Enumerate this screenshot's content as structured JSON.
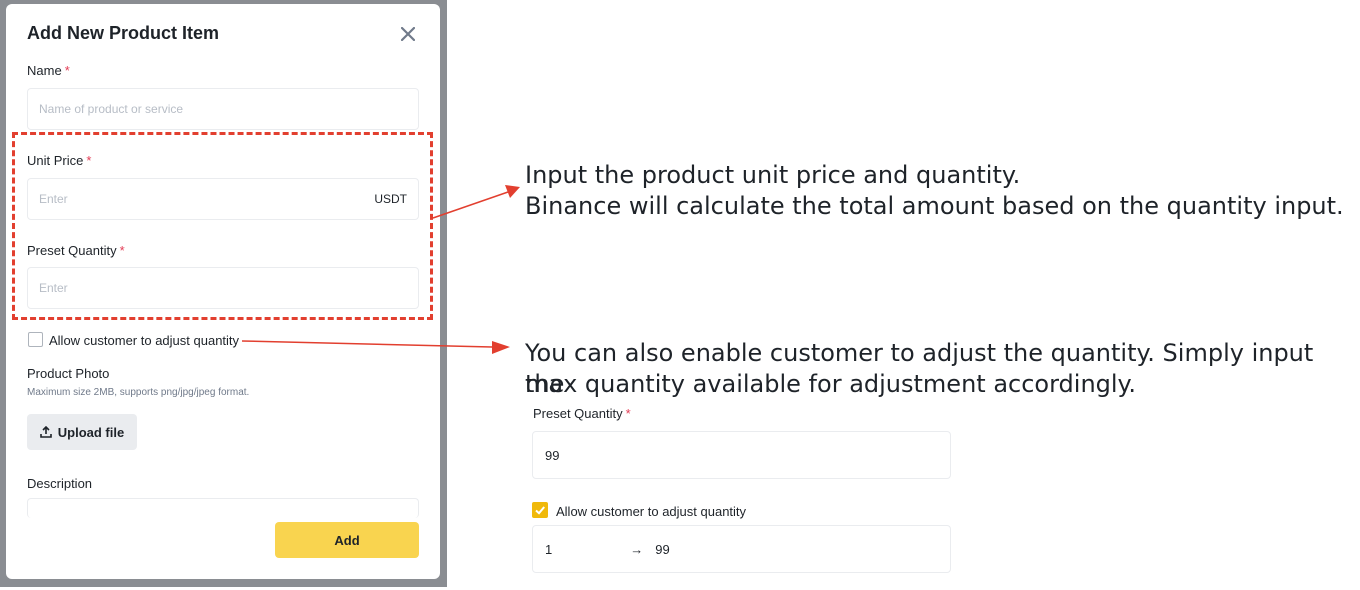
{
  "modal": {
    "title": "Add New Product Item",
    "name_label": "Name",
    "name_placeholder": "Name of product or service",
    "unit_price_label": "Unit Price",
    "unit_price_placeholder": "Enter",
    "unit_price_suffix": "USDT",
    "preset_qty_label": "Preset Quantity",
    "preset_qty_placeholder": "Enter",
    "allow_adjust_label": "Allow customer to adjust quantity",
    "product_photo_label": "Product Photo",
    "product_photo_hint": "Maximum size 2MB, supports png/jpg/jpeg format.",
    "upload_label": "Upload file",
    "description_label": "Description",
    "add_label": "Add",
    "required_mark": "*"
  },
  "callouts": {
    "price_line1": "Input the product unit price and quantity.",
    "price_line2": "Binance will calculate the total amount based on the quantity input.",
    "adjust_line1": "You can also enable customer to adjust the quantity. Simply input the",
    "adjust_line2": "max quantity available for adjustment accordingly."
  },
  "example_panel": {
    "preset_qty_label": "Preset Quantity",
    "preset_qty_value": "99",
    "allow_adjust_label": "Allow customer to adjust quantity",
    "allow_adjust_checked": true,
    "range_min": "1",
    "range_arrow": "→",
    "range_max": "99"
  },
  "colors": {
    "accent": "#f0b90b",
    "add_button": "#f9d44f",
    "annotation_red": "#e23f2f",
    "required": "#e33b54"
  }
}
